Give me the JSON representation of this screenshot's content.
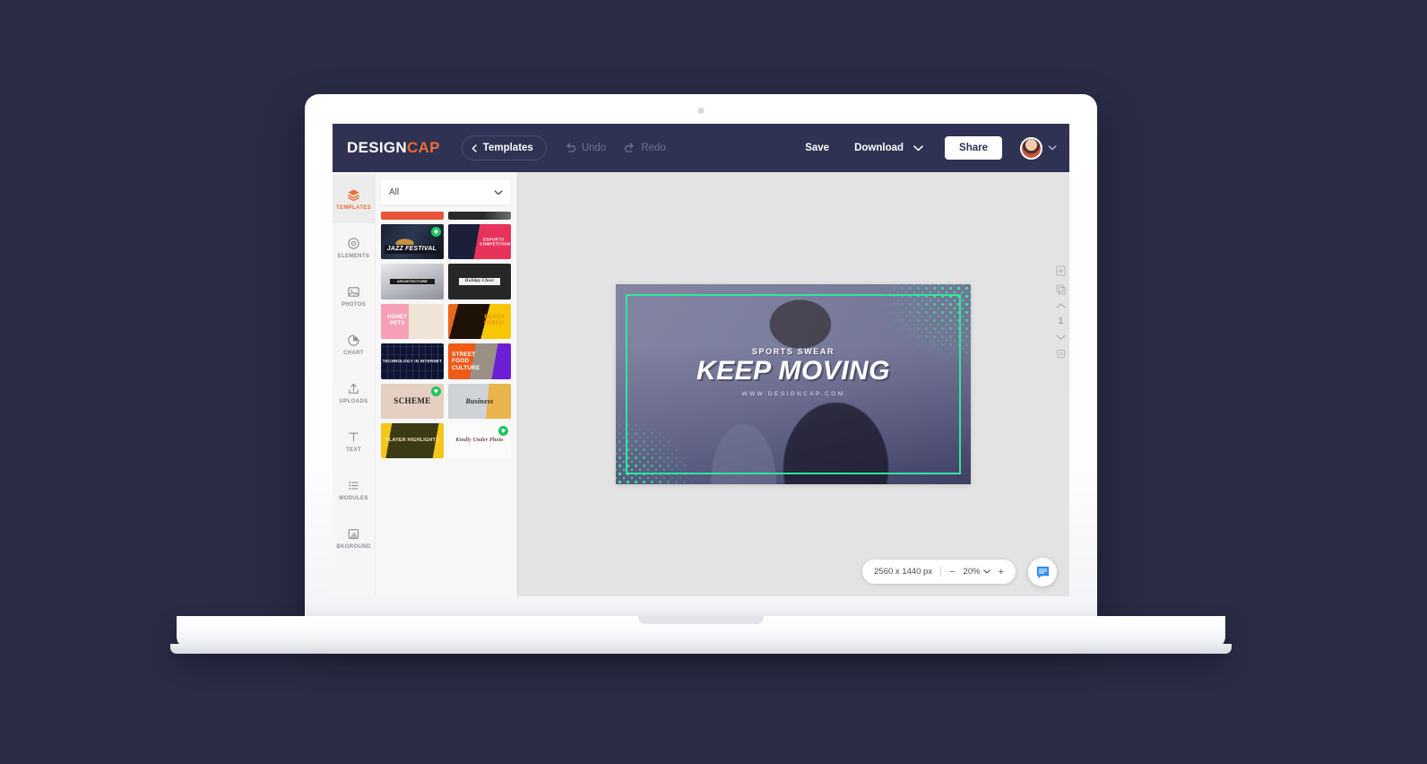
{
  "header": {
    "brand_first": "DESIGN",
    "brand_second": "CAP",
    "brand_accent_color": "#ed6c33",
    "templates_button": "Templates",
    "undo": "Undo",
    "redo": "Redo",
    "save": "Save",
    "download": "Download",
    "share": "Share"
  },
  "sidebar": {
    "items": [
      {
        "label": "TEMPLATES",
        "icon": "layers-icon",
        "active": true
      },
      {
        "label": "ELEMENTS",
        "icon": "gear-icon",
        "active": false
      },
      {
        "label": "PHOTOS",
        "icon": "image-icon",
        "active": false
      },
      {
        "label": "CHART",
        "icon": "pie-chart-icon",
        "active": false
      },
      {
        "label": "UPLOADS",
        "icon": "upload-icon",
        "active": false
      },
      {
        "label": "TEXT",
        "icon": "text-t-icon",
        "active": false
      },
      {
        "label": "MODULES",
        "icon": "list-icon",
        "active": false
      },
      {
        "label": "BKGROUND",
        "icon": "background-image-icon",
        "active": false
      }
    ]
  },
  "templates_panel": {
    "category_selected": "All",
    "thumbnails": [
      {
        "name": "orange-banner",
        "text": "",
        "art": "t-clip-orange",
        "clipped": true,
        "badge": false
      },
      {
        "name": "dark-banner",
        "text": "",
        "art": "t-clip-dark",
        "clipped": true,
        "badge": false
      },
      {
        "name": "jazz-festival",
        "text": "JAZZ FESTIVAL",
        "art": "t-jazz",
        "clipped": false,
        "badge": true
      },
      {
        "name": "esports-competition",
        "text": "ESPORTS COMPETITION",
        "art": "t-esports",
        "clipped": false,
        "badge": false
      },
      {
        "name": "architecture",
        "text": "ARCHITECTURE",
        "art": "t-arch",
        "clipped": false,
        "badge": false
      },
      {
        "name": "holiday-cheer",
        "text": "Holiday Cheer",
        "art": "t-holiday",
        "clipped": false,
        "badge": false
      },
      {
        "name": "honey-pets",
        "text": "HONEY PETS",
        "art": "t-honey",
        "clipped": false,
        "badge": false
      },
      {
        "name": "beach-party",
        "text": "BEACH PARTY!",
        "art": "t-beach",
        "clipped": false,
        "badge": false
      },
      {
        "name": "technology-internet",
        "text": "TECHNOLOGY IN INTERNET",
        "art": "t-tech",
        "clipped": false,
        "badge": false
      },
      {
        "name": "street-food-culture",
        "text": "STREET FOOD CULTURE",
        "art": "t-street",
        "clipped": false,
        "badge": false
      },
      {
        "name": "scheme",
        "text": "SCHEME",
        "art": "t-scheme",
        "clipped": false,
        "badge": true
      },
      {
        "name": "business",
        "text": "Business",
        "art": "t-business",
        "clipped": false,
        "badge": false
      },
      {
        "name": "player-highlights",
        "text": "PLAYER HIGHLIGHTS",
        "art": "t-player",
        "clipped": false,
        "badge": false
      },
      {
        "name": "floral-wedding",
        "text": "Kindly Under Photo",
        "art": "t-floral",
        "clipped": false,
        "badge": true
      }
    ]
  },
  "canvas": {
    "eyebrow": "SPORTS SWEAR",
    "headline": "KEEP MOVING",
    "url": "WWW.DESIGNCAP.COM",
    "accent_color": "#2ee89b",
    "page_number": "1"
  },
  "zoom_toolbar": {
    "dimensions": "2560 x 1440 px",
    "zoom_out": "−",
    "zoom_level": "20%",
    "zoom_in": "+"
  }
}
